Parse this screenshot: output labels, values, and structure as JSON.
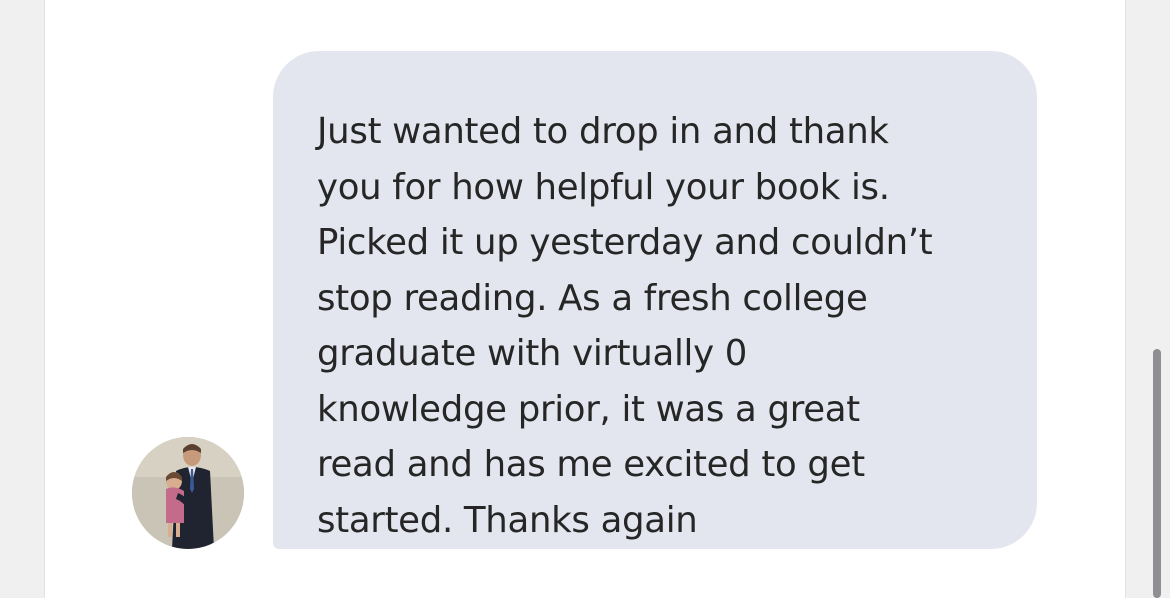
{
  "conversation": {
    "message": {
      "text": "Just wanted to drop in and thank\nyou for how helpful your book is.\nPicked it up yesterday and couldn’t\nstop reading. As a fresh college\ngraduate with virtually 0\nknowledge prior, it was a great\nread and has me excited to get\nstarted. Thanks again",
      "sender_avatar": "profile-photo-icon"
    }
  },
  "colors": {
    "page_background": "#f0f0f1",
    "panel_background": "#ffffff",
    "bubble_background": "#e4e6ef",
    "text": "#262626",
    "scrollbar_thumb": "#8e8e93"
  }
}
